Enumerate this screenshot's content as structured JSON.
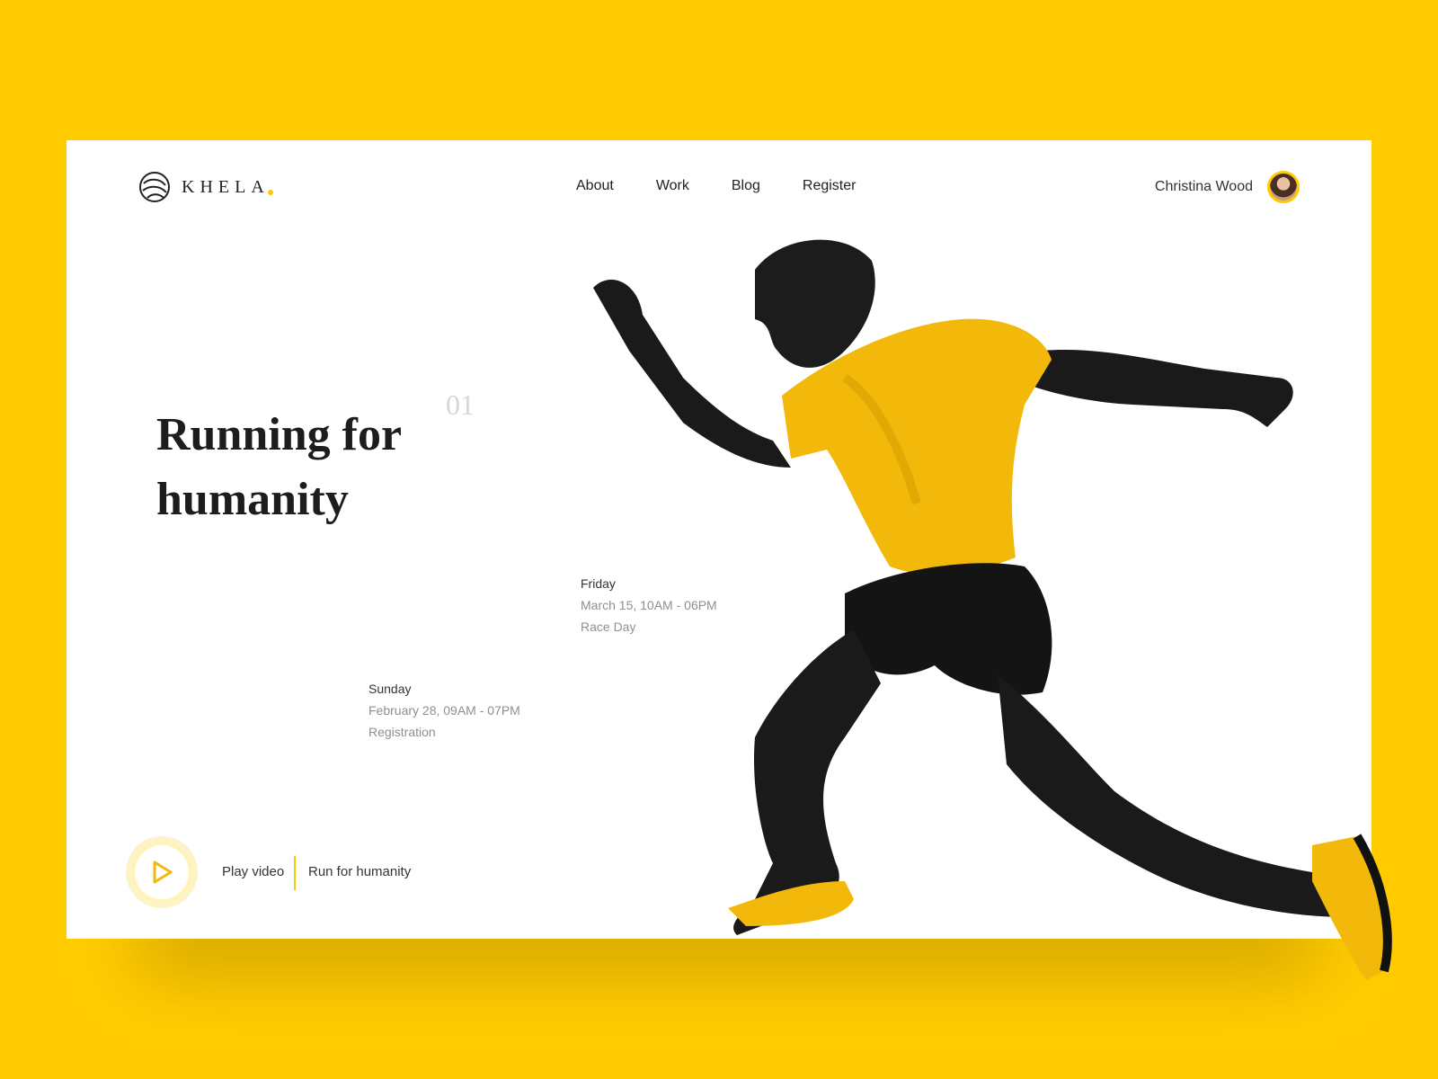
{
  "brand": {
    "name": "KHELA",
    "accent_color": "#FFCB00",
    "logo_icon": "globe-swirl-icon"
  },
  "nav": {
    "items": [
      "About",
      "Work",
      "Blog",
      "Register"
    ]
  },
  "user": {
    "name": "Christina Wood"
  },
  "hero": {
    "title": "Running for humanity",
    "slide_number": "01"
  },
  "events": [
    {
      "day": "Sunday",
      "time": "February 28, 09AM - 07PM",
      "label": "Registration"
    },
    {
      "day": "Friday",
      "time": "March 15, 10AM - 06PM",
      "label": "Race Day"
    }
  ],
  "footer": {
    "play_label": "Play video",
    "tagline": "Run for humanity",
    "play_icon": "play-icon"
  },
  "colors": {
    "background": "#FFCB00",
    "text": "#1d1d1d",
    "muted": "#8f8f8f"
  }
}
